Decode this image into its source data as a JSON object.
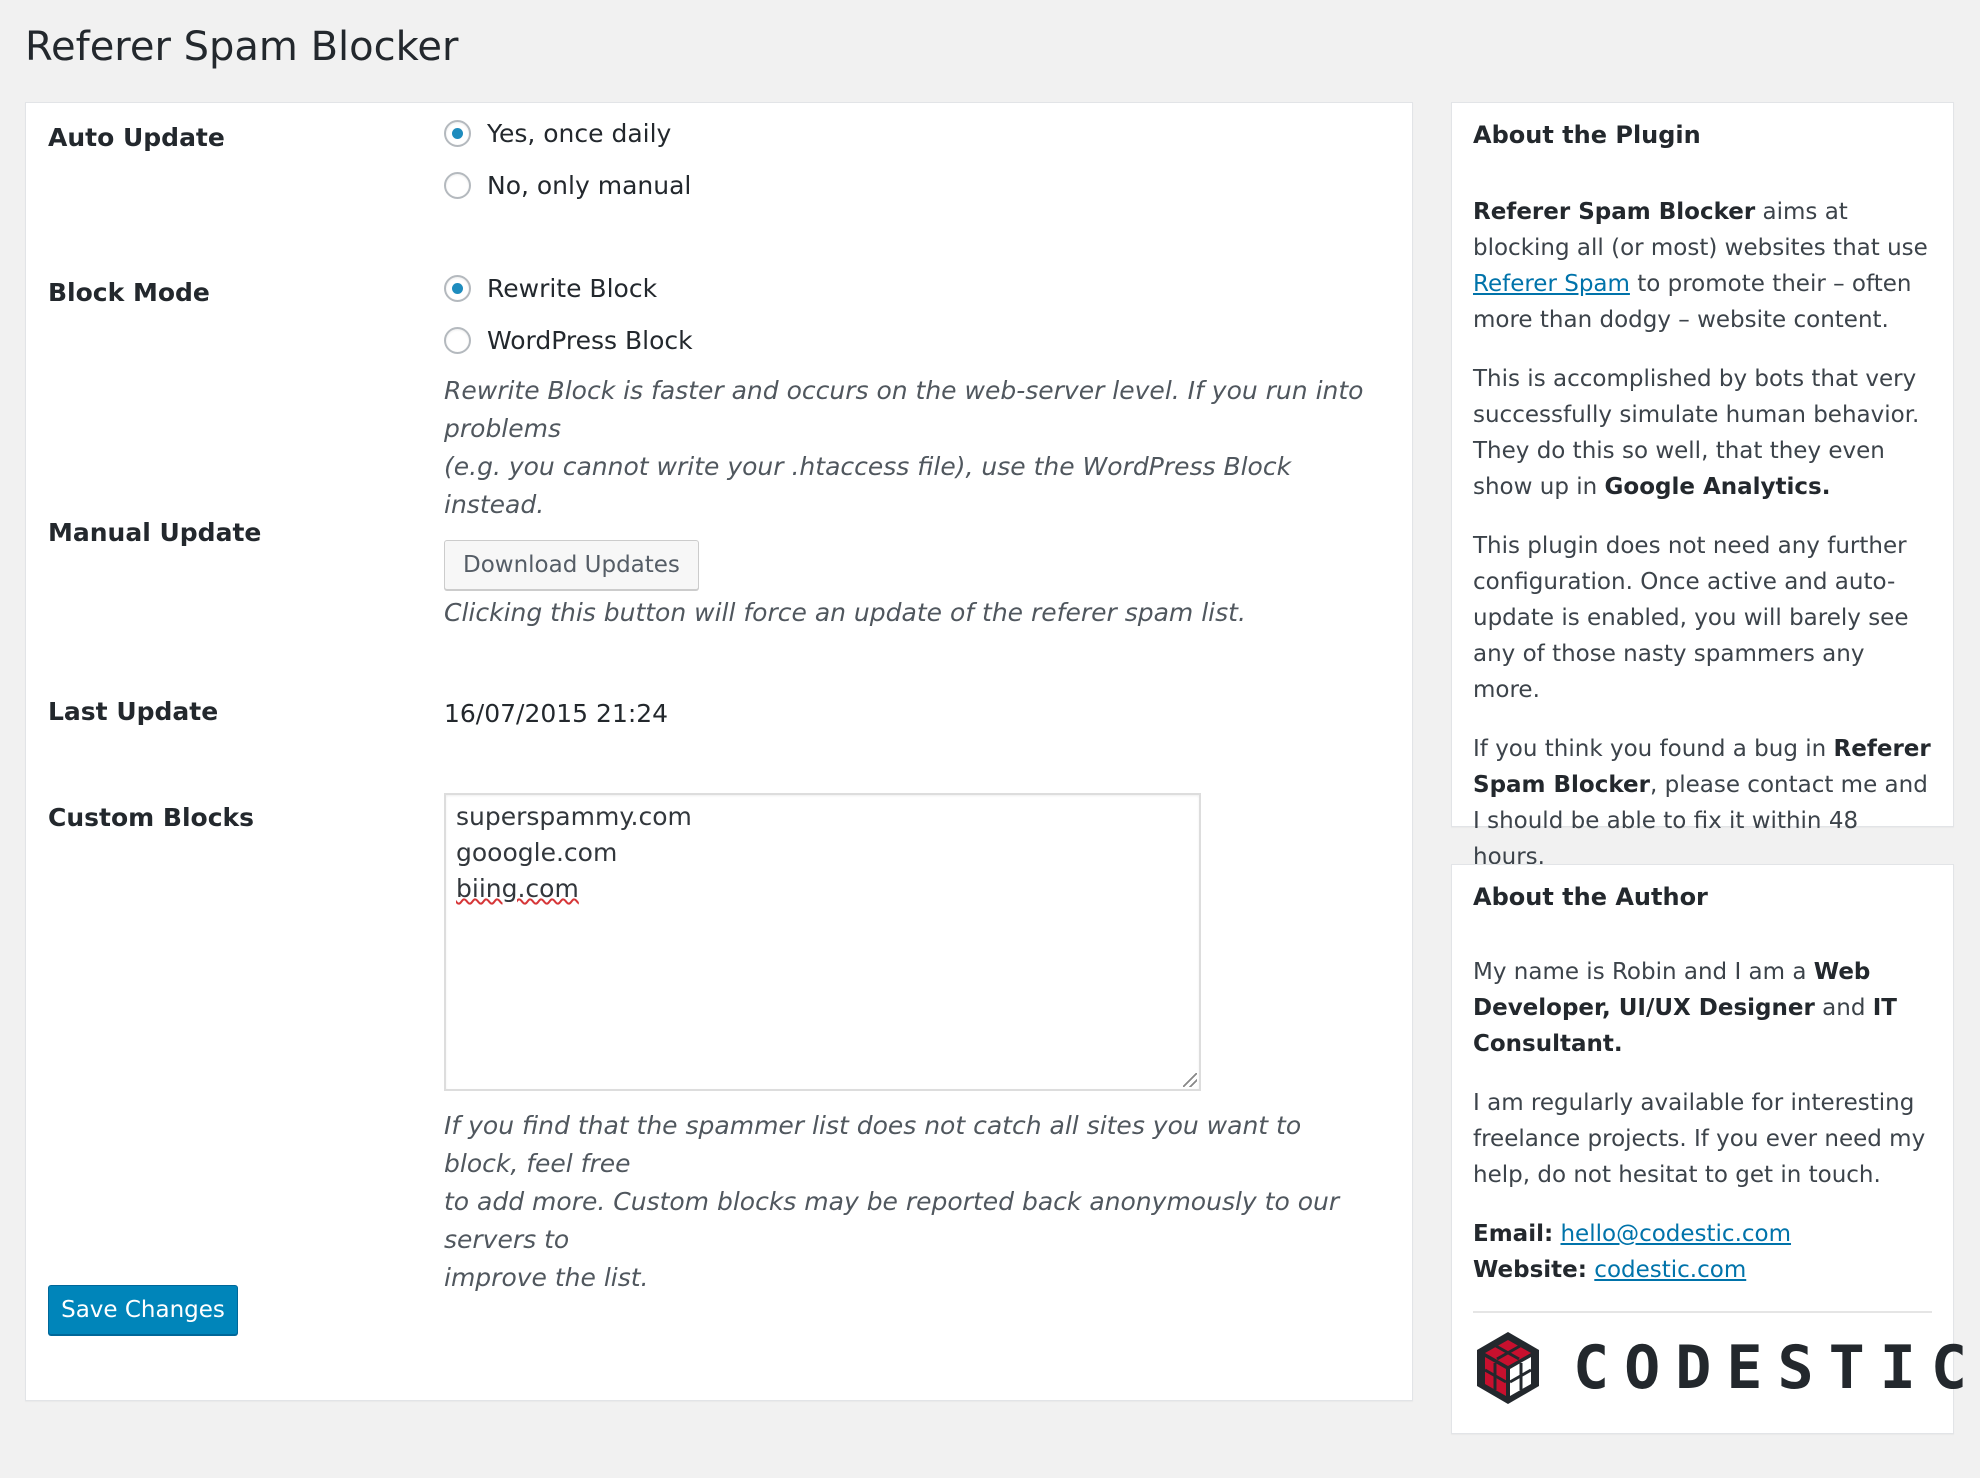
{
  "page": {
    "title": "Referer Spam Blocker"
  },
  "settings": {
    "auto_update": {
      "label": "Auto Update",
      "options": [
        {
          "label": "Yes, once daily",
          "checked": true
        },
        {
          "label": "No, only manual",
          "checked": false
        }
      ]
    },
    "block_mode": {
      "label": "Block Mode",
      "options": [
        {
          "label": "Rewrite Block",
          "checked": true
        },
        {
          "label": "WordPress Block",
          "checked": false
        }
      ],
      "description_line1": "Rewrite Block is faster and occurs on the web-server level. If you run into problems",
      "description_line2": "(e.g. you cannot write your .htaccess file), use the WordPress Block instead."
    },
    "manual_update": {
      "label": "Manual Update",
      "button_label": "Download Updates",
      "description": "Clicking this button will force an update of the referer spam list."
    },
    "last_update": {
      "label": "Last Update",
      "value": "16/07/2015 21:24"
    },
    "custom_blocks": {
      "label": "Custom Blocks",
      "lines": [
        "superspammy.com",
        "gooogle.com",
        "biing.com"
      ],
      "description_line1": "If you find that the spammer list does not catch all sites you want to block, feel free",
      "description_line2": "to add more. Custom blocks may be reported back anonymously to our servers to",
      "description_line3": "improve the list."
    },
    "save_label": "Save Changes"
  },
  "about_plugin": {
    "title": "About the Plugin",
    "p1_strong": "Referer Spam Blocker",
    "p1_text_a": " aims at blocking all (or most) websites that use ",
    "p1_link": "Referer Spam",
    "p1_text_b": " to promote their – often more than dodgy – website content.",
    "p2_text": "This is accomplished by bots that very successfully simulate human behavior. They do this so well, that they even show up in ",
    "p2_strong": "Google Analytics.",
    "p3_text": "This plugin does not need any further configuration. Once active and auto-update is enabled, you will barely see any of those nasty spammers any more.",
    "p4_text_a": "If you think you found a bug in ",
    "p4_strong": "Referer Spam Blocker",
    "p4_text_b": ", please contact me and I should be able to fix it within 48 hours."
  },
  "about_author": {
    "title": "About the Author",
    "p1_text": "My name is Robin and I am a ",
    "p1_strong1": "Web Developer, UI/UX Designer",
    "p1_and": " and ",
    "p1_strong2": "IT Consultant.",
    "p2_text": "I am regularly available for interesting freelance projects. If you ever need my help, do not hesitat to get in touch.",
    "email_label": "Email:",
    "email": "hello@codestic.com",
    "website_label": "Website:",
    "website": "codestic.com",
    "logo_text": "CODESTIC"
  },
  "colors": {
    "primary_button": "#0085ba",
    "link": "#0073aa",
    "radio_checked": "#1e8cbe",
    "logo_red": "#c8102e",
    "logo_dark": "#23282d"
  }
}
